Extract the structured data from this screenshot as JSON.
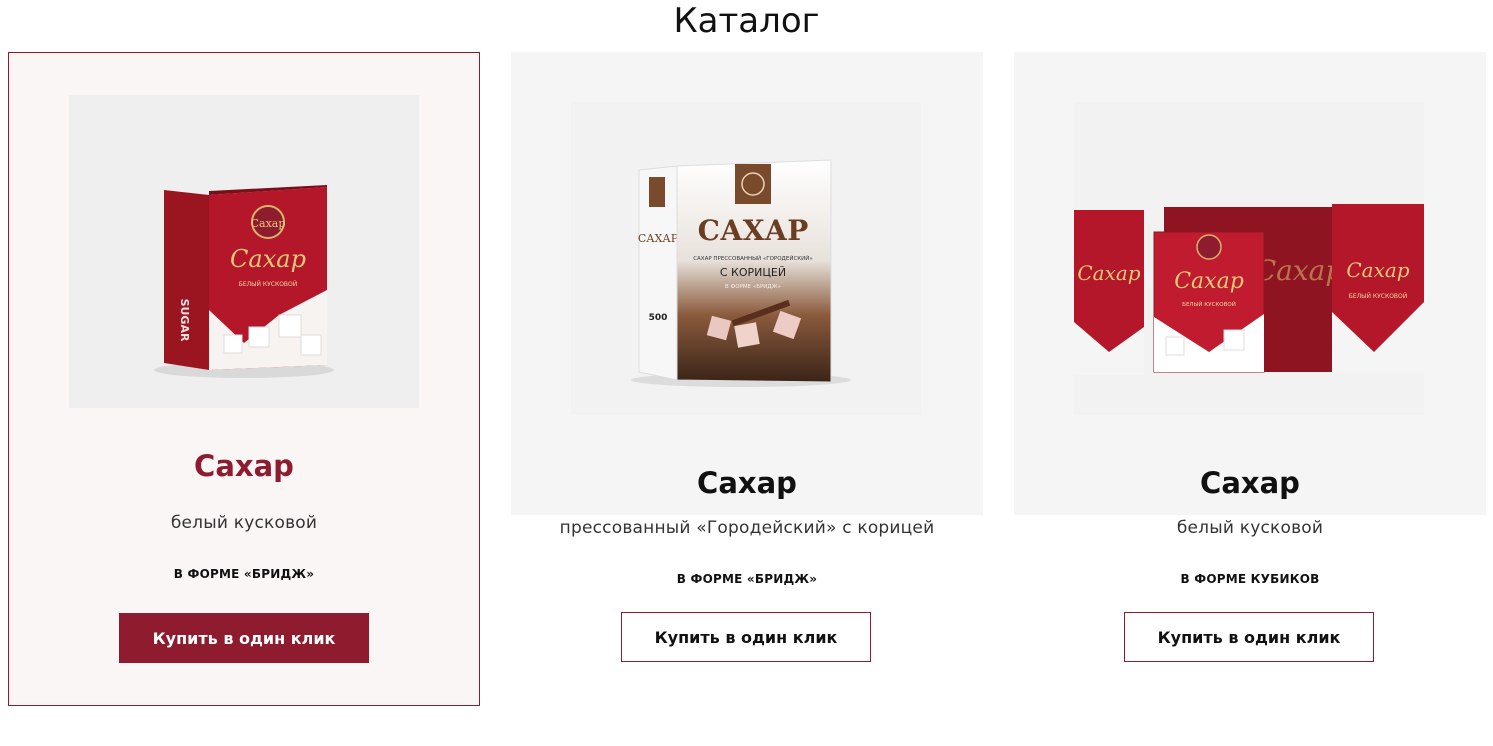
{
  "page": {
    "title": "Каталог"
  },
  "colors": {
    "accent": "#8e1b2e",
    "card_active_bg": "#fbf6f6",
    "media_bg": "#f5f5f5"
  },
  "products": [
    {
      "title": "Сахар",
      "subtitle": "белый кусковой",
      "form": "В ФОРМЕ «БРИДЖ»",
      "button": "Купить в один клик",
      "pack_label": "Сахар",
      "pack_caption": "БЕЛЫЙ КУСКОВОЙ",
      "side_text": "SUGAR"
    },
    {
      "title": "Сахар",
      "subtitle": "прессованный «Городейский» с корицей",
      "form": "В ФОРМЕ «БРИДЖ»",
      "button": "Купить в один клик",
      "pack_label": "САХАР",
      "pack_line1": "САХАР ПРЕССОВАННЫЙ «ГОРОДЕЙСКИЙ»",
      "pack_line2": "С КОРИЦЕЙ",
      "pack_line3": "В ФОРМЕ «БРИДЖ»",
      "side_weight": "500"
    },
    {
      "title": "Сахар",
      "subtitle": "белый кусковой",
      "form": "В ФОРМЕ КУБИКОВ",
      "button": "Купить в один клик",
      "pack_label": "Сахар",
      "pack_caption": "БЕЛЫЙ КУСКОВОЙ"
    }
  ]
}
